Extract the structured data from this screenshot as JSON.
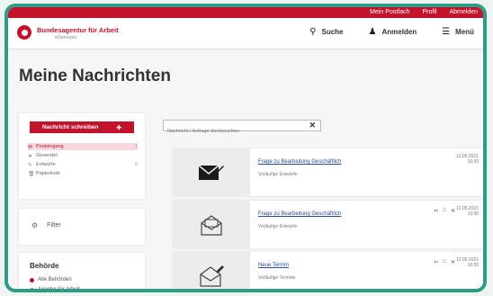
{
  "topbar": {
    "links": [
      "Mein Postfach",
      "Profil",
      "Abmelden"
    ]
  },
  "brand": {
    "name": "Bundesagentur für Arbeit",
    "subtitle": "eServices"
  },
  "nav": {
    "search": "Suche",
    "login": "Anmelden",
    "menu": "Menü"
  },
  "page": {
    "title": "Meine Nachrichten"
  },
  "sidebar": {
    "new_message_button": "Nachricht schreiben",
    "folders": [
      {
        "name": "Posteingang",
        "count": "1",
        "icon": "inbox-icon"
      },
      {
        "name": "Gesendet",
        "count": "",
        "icon": "sent-icon"
      },
      {
        "name": "Entwürfe",
        "count": "0",
        "icon": "draft-icon"
      },
      {
        "name": "Papierkorb",
        "count": "",
        "icon": "trash-icon"
      }
    ],
    "filter_label": "Filter",
    "section_title": "Behörde",
    "options": [
      "Alle Behörden",
      "Agentur für Arbeit"
    ]
  },
  "search": {
    "placeholder": "Nachricht / Anfrage durchsuchen",
    "value": ""
  },
  "messages": [
    {
      "subject": "Frage zu Bearbeitung Geschäftlich",
      "from": "Vorläufige Entwürfe",
      "date_line1": "12.05.2021",
      "date_line2": "10:30",
      "icon": "envelope-filled-icon"
    },
    {
      "subject": "Frage zu Bearbeitung Geschäftlich",
      "from": "Vorläufige Entwürfe",
      "date_line1": "12.05.2021",
      "date_line2": "10:30",
      "icon": "envelope-open-icon"
    },
    {
      "subject": "Neue Termin",
      "from": "Vorläufige Termine",
      "date_line1": "12.05.2021",
      "date_line2": "10:30",
      "icon": "envelope-edit-icon"
    }
  ],
  "colors": {
    "brand_red": "#c3122b",
    "frame_teal": "#2f9c86"
  }
}
